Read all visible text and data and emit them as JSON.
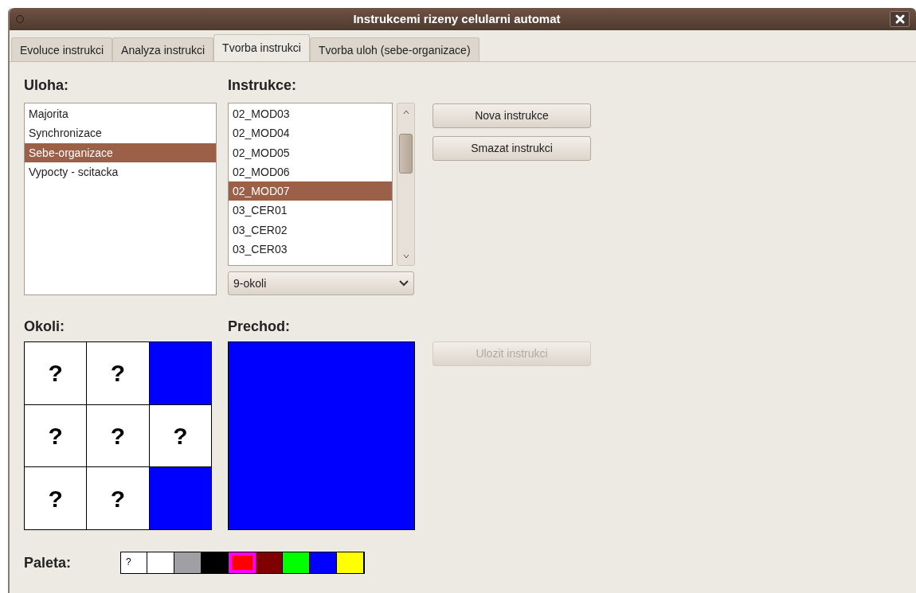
{
  "window": {
    "title": "Instrukcemi rizeny celularni automat"
  },
  "tabs": [
    {
      "label": "Evoluce instrukci",
      "selected": false
    },
    {
      "label": "Analyza instrukci",
      "selected": false
    },
    {
      "label": "Tvorba instrukci",
      "selected": true
    },
    {
      "label": "Tvorba uloh (sebe-organizace)",
      "selected": false
    }
  ],
  "tasks": {
    "label": "Uloha:",
    "items": [
      {
        "label": "Majorita",
        "selected": false
      },
      {
        "label": "Synchronizace",
        "selected": false
      },
      {
        "label": "Sebe-organizace",
        "selected": true
      },
      {
        "label": "Vypocty - scitacka",
        "selected": false
      }
    ]
  },
  "instructions": {
    "label": "Instrukce:",
    "items": [
      {
        "label": "02_MOD03",
        "selected": false
      },
      {
        "label": "02_MOD04",
        "selected": false
      },
      {
        "label": "02_MOD05",
        "selected": false
      },
      {
        "label": "02_MOD06",
        "selected": false
      },
      {
        "label": "02_MOD07",
        "selected": true
      },
      {
        "label": "03_CER01",
        "selected": false
      },
      {
        "label": "03_CER02",
        "selected": false
      },
      {
        "label": "03_CER03",
        "selected": false
      }
    ],
    "dropdown": {
      "value": "9-okoli"
    }
  },
  "buttons": [
    {
      "label": "Nova instrukce",
      "disabled": false
    },
    {
      "label": "Smazat instrukci",
      "disabled": false
    }
  ],
  "neighborhood": {
    "label": "Okoli:",
    "cells": [
      {
        "kind": "unknown",
        "text": "?"
      },
      {
        "kind": "unknown",
        "text": "?"
      },
      {
        "kind": "color",
        "color": "#0000ff"
      },
      {
        "kind": "unknown",
        "text": "?"
      },
      {
        "kind": "unknown",
        "text": "?"
      },
      {
        "kind": "unknown",
        "text": "?"
      },
      {
        "kind": "unknown",
        "text": "?"
      },
      {
        "kind": "unknown",
        "text": "?"
      },
      {
        "kind": "color",
        "color": "#0000ff"
      }
    ]
  },
  "transition": {
    "label": "Prechod:",
    "color": "#0000ff"
  },
  "save_button": {
    "label": "Ulozit instrukci",
    "disabled": true
  },
  "palette": {
    "label": "Paleta:",
    "items": [
      {
        "kind": "unknown",
        "text": "?",
        "selected": false
      },
      {
        "kind": "color",
        "color": "#ffffff",
        "selected": false
      },
      {
        "kind": "color",
        "color": "#a0a0a4",
        "selected": false
      },
      {
        "kind": "color",
        "color": "#000000",
        "selected": false
      },
      {
        "kind": "color",
        "color": "#ff0000",
        "selected": true
      },
      {
        "kind": "color",
        "color": "#800000",
        "selected": false
      },
      {
        "kind": "color",
        "color": "#00ff00",
        "selected": false
      },
      {
        "kind": "color",
        "color": "#0000ff",
        "selected": false
      },
      {
        "kind": "color",
        "color": "#ffff00",
        "selected": false
      }
    ]
  }
}
